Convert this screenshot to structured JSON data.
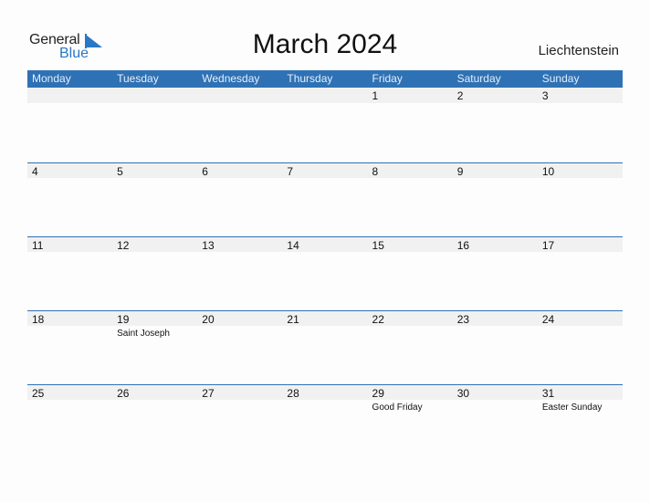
{
  "logo": {
    "line1": "General",
    "line2": "Blue"
  },
  "title": "March 2024",
  "country": "Liechtenstein",
  "colors": {
    "header_bg": "#2e72b5",
    "date_strip": "#f1f1f1",
    "brand_blue": "#2a77c8"
  },
  "weekdays": [
    "Monday",
    "Tuesday",
    "Wednesday",
    "Thursday",
    "Friday",
    "Saturday",
    "Sunday"
  ],
  "weeks": [
    [
      {
        "day": ""
      },
      {
        "day": ""
      },
      {
        "day": ""
      },
      {
        "day": ""
      },
      {
        "day": "1"
      },
      {
        "day": "2"
      },
      {
        "day": "3"
      }
    ],
    [
      {
        "day": "4"
      },
      {
        "day": "5"
      },
      {
        "day": "6"
      },
      {
        "day": "7"
      },
      {
        "day": "8"
      },
      {
        "day": "9"
      },
      {
        "day": "10"
      }
    ],
    [
      {
        "day": "11"
      },
      {
        "day": "12"
      },
      {
        "day": "13"
      },
      {
        "day": "14"
      },
      {
        "day": "15"
      },
      {
        "day": "16"
      },
      {
        "day": "17"
      }
    ],
    [
      {
        "day": "18"
      },
      {
        "day": "19",
        "holiday": "Saint Joseph"
      },
      {
        "day": "20"
      },
      {
        "day": "21"
      },
      {
        "day": "22"
      },
      {
        "day": "23"
      },
      {
        "day": "24"
      }
    ],
    [
      {
        "day": "25"
      },
      {
        "day": "26"
      },
      {
        "day": "27"
      },
      {
        "day": "28"
      },
      {
        "day": "29",
        "holiday": "Good Friday"
      },
      {
        "day": "30"
      },
      {
        "day": "31",
        "holiday": "Easter Sunday"
      }
    ]
  ]
}
